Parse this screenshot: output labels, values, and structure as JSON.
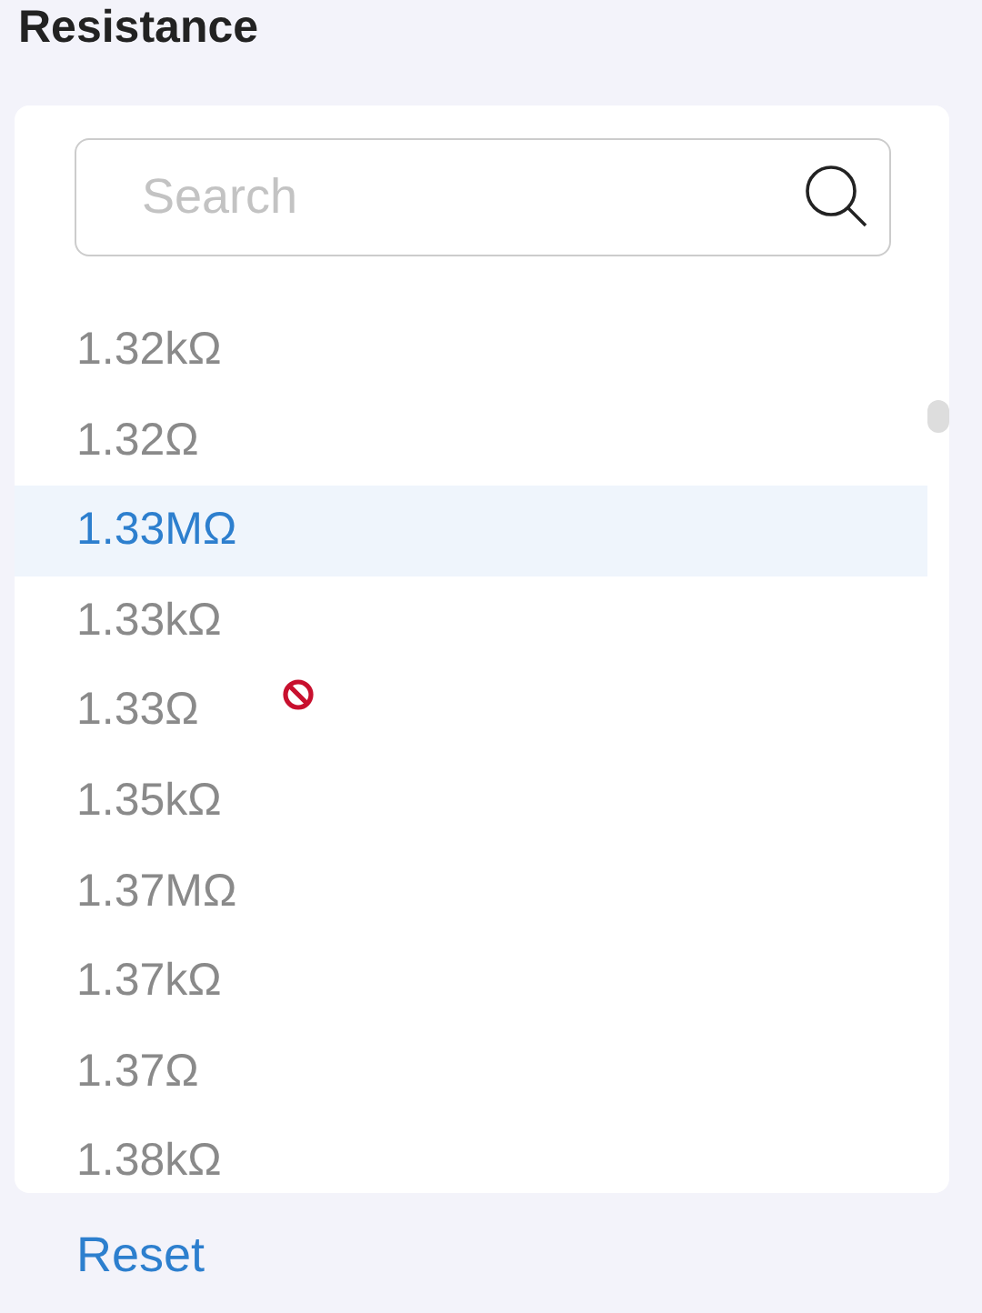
{
  "title": "Resistance",
  "search": {
    "placeholder": "Search"
  },
  "options": [
    {
      "label": "1.32kΩ",
      "selected": false
    },
    {
      "label": "1.32Ω",
      "selected": false
    },
    {
      "label": "1.33MΩ",
      "selected": true
    },
    {
      "label": "1.33kΩ",
      "selected": false
    },
    {
      "label": "1.33Ω",
      "selected": false
    },
    {
      "label": "1.35kΩ",
      "selected": false
    },
    {
      "label": "1.37MΩ",
      "selected": false
    },
    {
      "label": "1.37kΩ",
      "selected": false
    },
    {
      "label": "1.37Ω",
      "selected": false
    },
    {
      "label": "1.38kΩ",
      "selected": false
    }
  ],
  "reset_link": "Reset"
}
